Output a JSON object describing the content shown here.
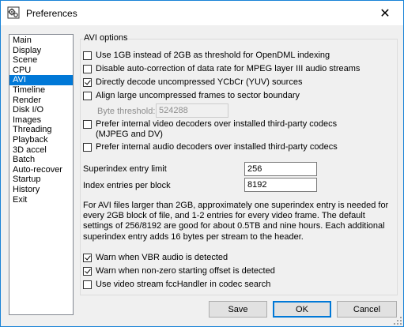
{
  "window": {
    "title": "Preferences",
    "close_glyph": "✕"
  },
  "nav": {
    "items": [
      "Main",
      "Display",
      "Scene",
      "CPU",
      "AVI",
      "Timeline",
      "Render",
      "Disk I/O",
      "Images",
      "Threading",
      "Playback",
      "3D accel",
      "Batch",
      "Auto-recover",
      "Startup",
      "History",
      "Exit"
    ],
    "selected": "AVI"
  },
  "avi": {
    "group_title": "AVI options",
    "options": [
      {
        "label": "Use 1GB instead of 2GB as threshold for OpenDML indexing",
        "checked": false
      },
      {
        "label": "Disable auto-correction of data rate for MPEG layer III audio streams",
        "checked": false
      },
      {
        "label": "Directly decode uncompressed YCbCr (YUV) sources",
        "checked": true
      },
      {
        "label": "Align large uncompressed frames to sector boundary",
        "checked": false
      },
      {
        "label": "Prefer internal video decoders over installed third-party codecs (MJPEG and DV)",
        "checked": false
      },
      {
        "label": "Prefer internal audio decoders over installed third-party codecs",
        "checked": false
      }
    ],
    "byte_threshold_label": "Byte threshold:",
    "byte_threshold_value": "524288",
    "superindex_label": "Superindex entry limit",
    "superindex_value": "256",
    "index_entries_label": "Index entries per block",
    "index_entries_value": "8192",
    "info_text": "For AVI files larger than 2GB, approximately one superindex entry is needed for every 2GB block of file, and 1-2 entries for every video frame. The default settings of 256/8192 are good for about 0.5TB and nine hours. Each additional superindex entry adds 16 bytes per stream to the header.",
    "bottom_options": [
      {
        "label": "Warn when VBR audio is detected",
        "checked": true
      },
      {
        "label": "Warn when non-zero starting offset is detected",
        "checked": true
      },
      {
        "label": "Use video stream fccHandler in codec search",
        "checked": false
      }
    ]
  },
  "buttons": {
    "save": "Save",
    "ok": "OK",
    "cancel": "Cancel"
  },
  "icons": {
    "app": "preferences-gears-icon",
    "close": "close-icon",
    "grip": "resize-grip-icon"
  }
}
